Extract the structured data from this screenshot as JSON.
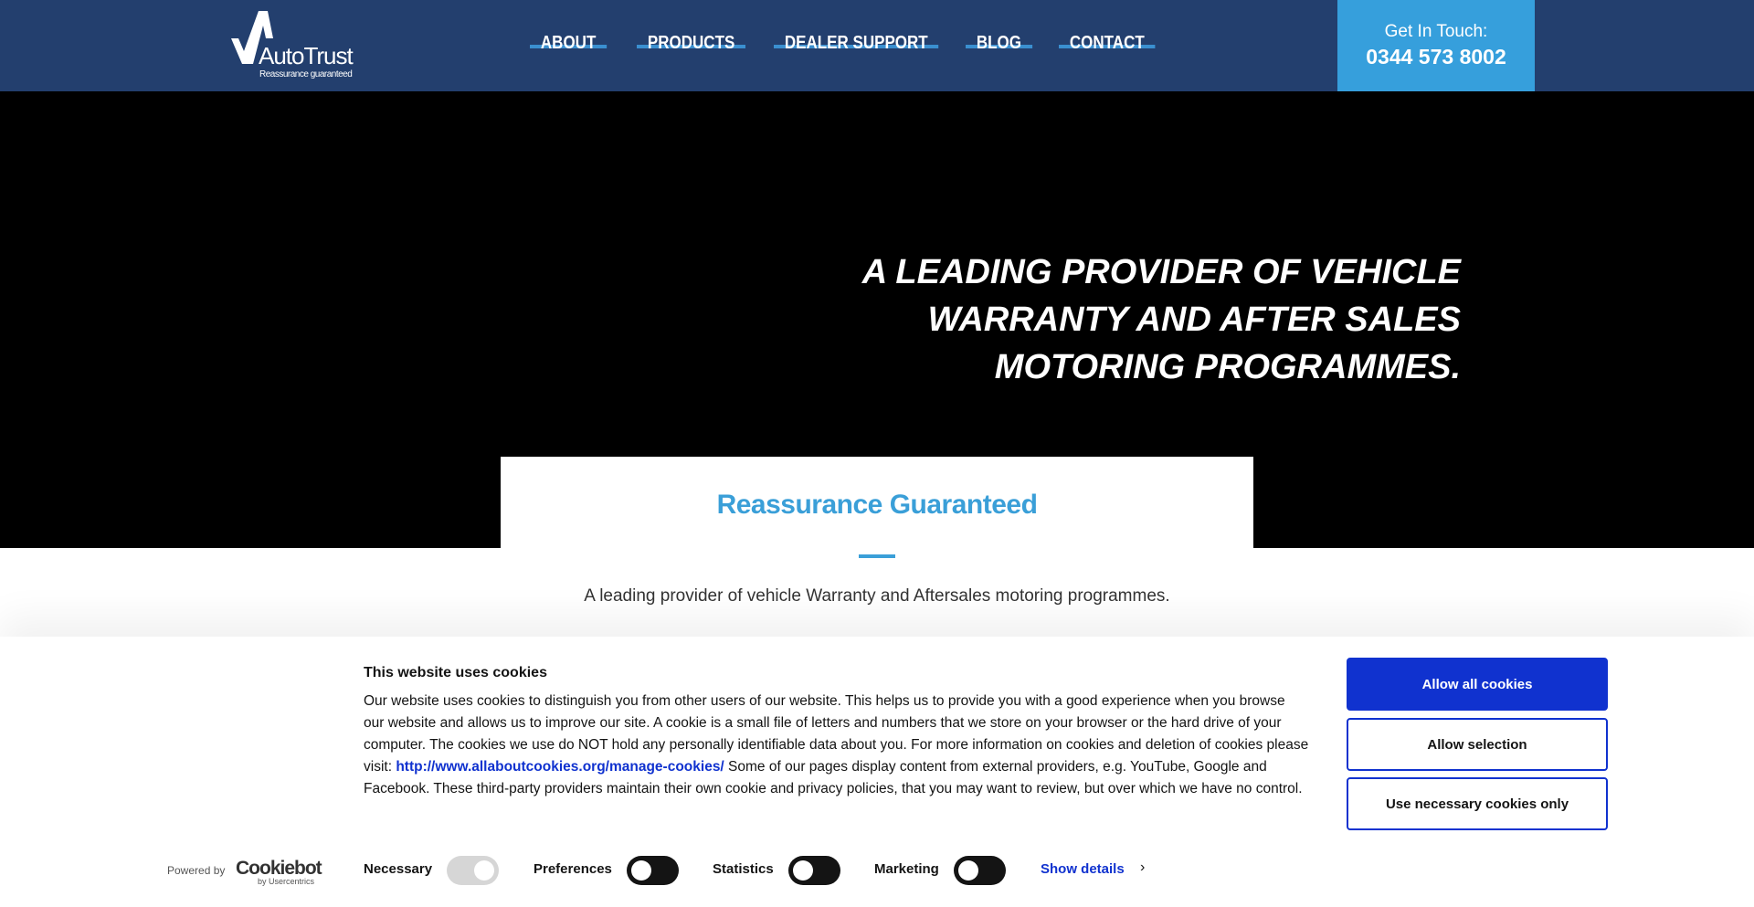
{
  "header": {
    "logo": {
      "name": "AutoTrust",
      "tagline": "Reassurance guaranteed"
    },
    "nav": [
      {
        "label": "ABOUT"
      },
      {
        "label": "PRODUCTS"
      },
      {
        "label": "DEALER SUPPORT"
      },
      {
        "label": "BLOG"
      },
      {
        "label": "CONTACT"
      }
    ],
    "contact": {
      "label": "Get In Touch:",
      "phone": "0344 573 8002"
    }
  },
  "hero": {
    "title_lines": [
      "A leading provider of vehicle",
      "warranty and after sales",
      "motoring programmes."
    ]
  },
  "card": {
    "title": "Reassurance Guaranteed",
    "subtitle": "A leading provider of vehicle Warranty and Aftersales motoring programmes."
  },
  "cookie": {
    "title": "This website uses cookies",
    "body_before": "Our website uses cookies to distinguish you from other users of our website. This helps us to provide you with a good experience when you browse our website and allows us to improve our site. A cookie is a small file of letters and numbers that we store on your browser or the hard drive of your computer. The cookies we use do NOT hold any personally identifiable data about you. For more information on cookies and deletion of cookies please visit: ",
    "link": "http://www.allaboutcookies.org/manage-cookies/",
    "body_after": " Some of our pages display content from external providers, e.g. YouTube, Google and Facebook. These third-party providers maintain their own cookie and privacy policies, that you may want to review, but over which we have no control.",
    "buttons": {
      "allow_all": "Allow all cookies",
      "allow_selection": "Allow selection",
      "necessary_only": "Use necessary cookies only"
    },
    "powered_by": "Powered by",
    "brand": "Cookiebot",
    "brand_sub": "by Usercentrics",
    "toggles": [
      {
        "label": "Necessary",
        "on": true,
        "disabled": true
      },
      {
        "label": "Preferences",
        "on": false
      },
      {
        "label": "Statistics",
        "on": false
      },
      {
        "label": "Marketing",
        "on": false
      }
    ],
    "show_details": "Show details"
  },
  "colors": {
    "header": "#233f6e",
    "accent": "#369fdc",
    "cookie_primary": "#1032cf"
  }
}
